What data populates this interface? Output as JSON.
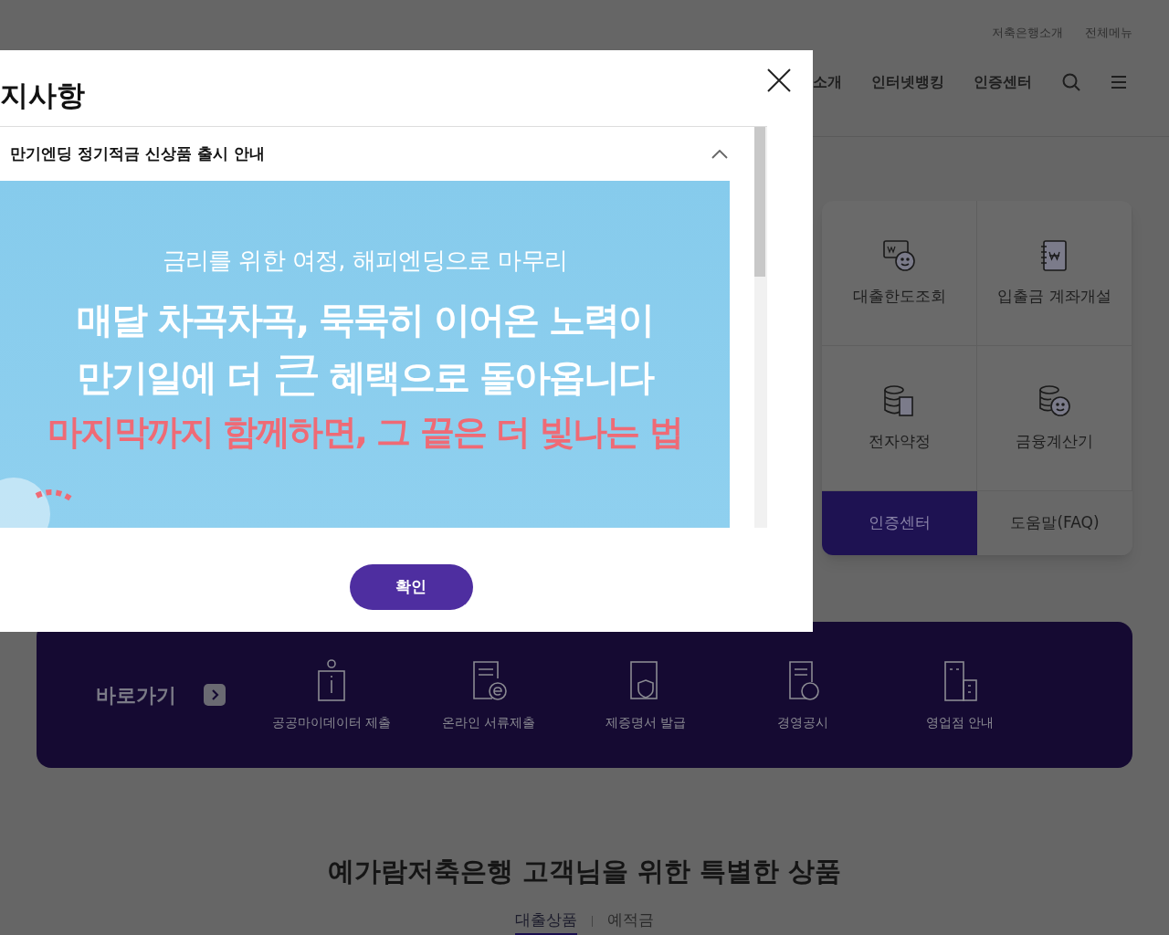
{
  "header": {
    "utility_links": [
      "저축은행소개",
      "전체메뉴"
    ],
    "nav": [
      "소개",
      "인터넷뱅킹",
      "인증센터"
    ]
  },
  "quick_menu": {
    "items": [
      "대출한도조회",
      "입출금 계좌개설",
      "전자약정",
      "금융계산기"
    ],
    "bottom": [
      {
        "label": "인증센터",
        "highlighted": true
      },
      {
        "label": "도움말(FAQ)",
        "highlighted": false
      }
    ]
  },
  "shortcut_bar": {
    "title": "바로가기",
    "items": [
      "공공마이데이터 제출",
      "온라인 서류제출",
      "제증명서 발급",
      "경영공시",
      "영업점 안내"
    ]
  },
  "products": {
    "title": "예가람저축은행 고객님을 위한 특별한 상품",
    "tabs": [
      {
        "label": "대출상품",
        "selected": true
      },
      {
        "label": "예적금",
        "selected": false
      }
    ]
  },
  "modal": {
    "title": "지사항",
    "notice": {
      "title": "만기엔딩 정기적금 신상품 출시 안내",
      "expanded": true,
      "banner": {
        "subtitle": "금리를 위한 여정, 해피엔딩으로 마무리",
        "line_1": "매달 차곡차곡, 묵묵히 이어온 노력이",
        "line_2": {
          "before": "만기일에 더",
          "emphasis": "큰",
          "after": "혜택으로 돌아옵니다"
        },
        "tagline": "마지막까지 함께하면, 그 끝은 더 빛나는 법"
      }
    },
    "confirm": "확인"
  }
}
